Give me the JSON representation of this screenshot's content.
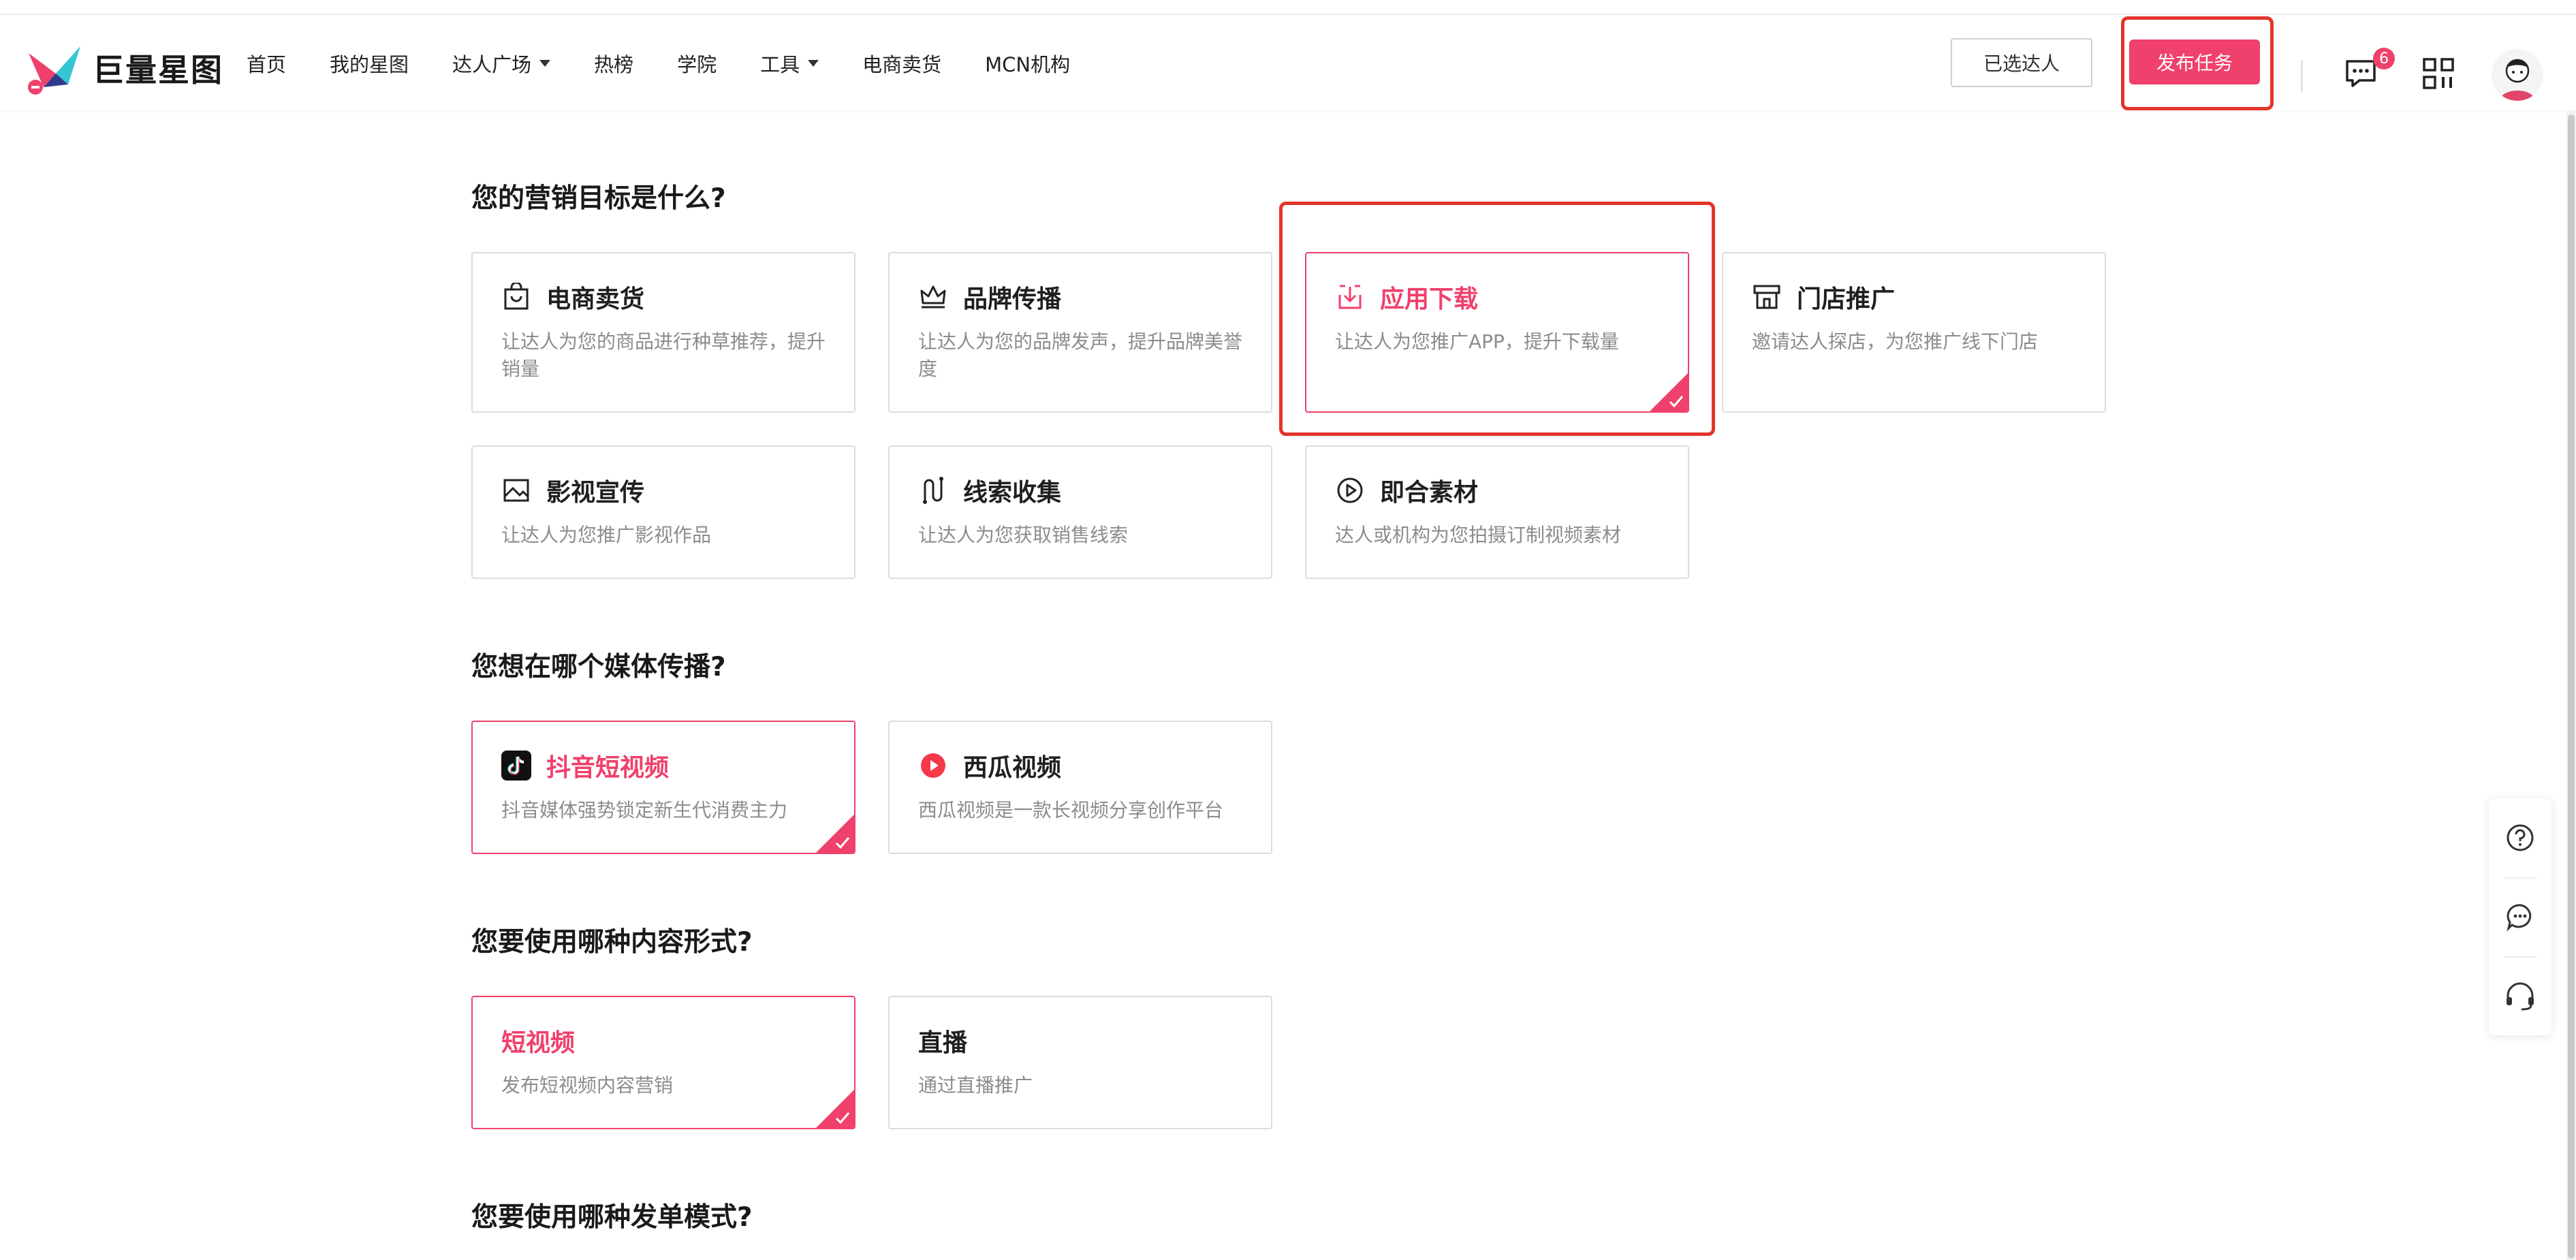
{
  "header": {
    "logo_text": "巨量星图",
    "nav": [
      "首页",
      "我的星图",
      "达人广场",
      "热榜",
      "学院",
      "工具",
      "电商卖货",
      "MCN机构"
    ],
    "selected_creators_label": "已选达人",
    "publish_label": "发布任务",
    "message_badge": "6"
  },
  "sections": {
    "goal_title": "您的营销目标是什么?",
    "media_title": "您想在哪个媒体传播?",
    "format_title": "您要使用哪种内容形式?",
    "mode_title": "您要使用哪种发单模式?"
  },
  "goals": [
    {
      "title": "电商卖货",
      "desc": "让达人为您的商品进行种草推荐，提升销量",
      "icon": "shopping-bag-icon",
      "selected": false
    },
    {
      "title": "品牌传播",
      "desc": "让达人为您的品牌发声，提升品牌美誉度",
      "icon": "crown-icon",
      "selected": false
    },
    {
      "title": "应用下载",
      "desc": "让达人为您推广APP，提升下载量",
      "icon": "download-icon",
      "selected": true
    },
    {
      "title": "门店推广",
      "desc": "邀请达人探店，为您推广线下门店",
      "icon": "store-icon",
      "selected": false
    },
    {
      "title": "影视宣传",
      "desc": "让达人为您推广影视作品",
      "icon": "image-icon",
      "selected": false
    },
    {
      "title": "线索收集",
      "desc": "让达人为您获取销售线索",
      "icon": "route-icon",
      "selected": false
    },
    {
      "title": "即合素材",
      "desc": "达人或机构为您拍摄订制视频素材",
      "icon": "play-circle-icon",
      "selected": false
    }
  ],
  "media": [
    {
      "title": "抖音短视频",
      "desc": "抖音媒体强势锁定新生代消费主力",
      "icon": "douyin-icon",
      "selected": true
    },
    {
      "title": "西瓜视频",
      "desc": "西瓜视频是一款长视频分享创作平台",
      "icon": "xigua-icon",
      "selected": false
    }
  ],
  "formats": [
    {
      "title": "短视频",
      "desc": "发布短视频内容营销",
      "selected": true
    },
    {
      "title": "直播",
      "desc": "通过直播推广",
      "selected": false
    }
  ],
  "colors": {
    "accent": "#f0406c",
    "highlight": "#e2362a",
    "border": "#dcdcdc",
    "desc_text": "#8c8c8c"
  }
}
